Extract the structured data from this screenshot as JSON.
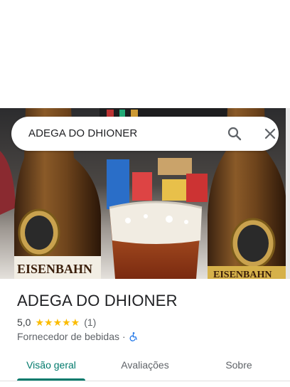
{
  "search": {
    "query": "ADEGA DO DHIONER"
  },
  "hero": {
    "bottle_left_label": "EISENBAHN",
    "bottle_right_label": "EISENBAHN"
  },
  "place": {
    "name": "ADEGA DO DHIONER",
    "rating_value": "5,0",
    "stars": "★★★★★",
    "review_count": "(1)",
    "category": "Fornecedor de bebidas",
    "separator": "·"
  },
  "tabs": [
    {
      "label": "Visão geral",
      "active": true
    },
    {
      "label": "Avaliações",
      "active": false
    },
    {
      "label": "Sobre",
      "active": false
    }
  ],
  "colors": {
    "accent": "#00796b",
    "star": "#fbbc04",
    "accessibility": "#1a73e8"
  }
}
